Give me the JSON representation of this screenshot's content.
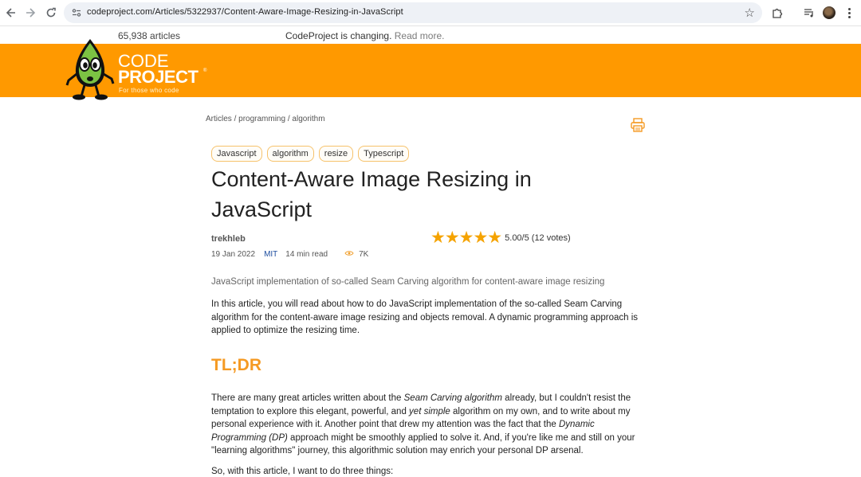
{
  "browser": {
    "url": "codeproject.com/Articles/5322937/Content-Aware-Image-Resizing-in-JavaScript"
  },
  "topstrip": {
    "article_count": "65,938 articles",
    "notice": "CodeProject is changing.",
    "notice_link": "Read more."
  },
  "logo": {
    "code": "CODE",
    "project": "PROJECT",
    "reg": "®",
    "tagline": "For those who code"
  },
  "breadcrumb": {
    "items": [
      "Articles",
      "programming",
      "algorithm"
    ],
    "separator": " / "
  },
  "tags": [
    "Javascript",
    "algorithm",
    "resize",
    "Typescript"
  ],
  "article": {
    "title": "Content-Aware Image Resizing in JavaScript",
    "author": "trekhleb",
    "date": "19 Jan 2022",
    "license": "MIT",
    "read_time": "14 min read",
    "views": "7K",
    "rating_stars": "★★★★★",
    "rating_text": "5.00/5 (12 votes)",
    "subtitle": "JavaScript implementation of so-called Seam Carving algorithm for content-aware image resizing",
    "intro": "In this article, you will read about how to do JavaScript implementation of the so-called Seam Carving algorithm for the content-aware image resizing and objects removal. A dynamic programming approach is applied to optimize the resizing time.",
    "tldr_heading": "TL;DR",
    "p2_a": "There are many great articles written about the ",
    "p2_b": "Seam Carving algorithm",
    "p2_c": " already, but I couldn't resist the temptation to explore this elegant, powerful, and ",
    "p2_d": "yet simple",
    "p2_e": " algorithm on my own, and to write about my personal experience with it. Another point that drew my attention was the fact that the ",
    "p2_f": "Dynamic Programming (DP)",
    "p2_g": " approach might be smoothly applied to solve it. And, if you're like me and still on your \"learning algorithms\" journey, this algorithmic solution may enrich your personal DP arsenal.",
    "p3": "So, with this article, I want to do three things:"
  },
  "colors": {
    "brand_orange": "#ff9900",
    "heading_orange": "#f59a23",
    "star_gold": "#f5a300",
    "license_blue": "#1f4fa0"
  },
  "icons": {
    "back": "arrow-left-icon",
    "forward": "arrow-right-icon",
    "reload": "reload-icon",
    "site_info": "tune-icon",
    "bookmark": "star-outline-icon",
    "extensions": "puzzle-icon",
    "media": "media-queue-icon",
    "print": "printer-icon",
    "views": "eye-icon"
  }
}
